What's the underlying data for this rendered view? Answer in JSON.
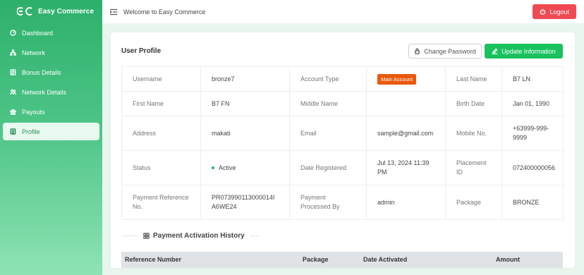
{
  "brand": {
    "name": "Easy Commerce"
  },
  "sidebar": {
    "items": [
      {
        "label": "Dashboard",
        "icon": "dashboard-icon"
      },
      {
        "label": "Network",
        "icon": "network-icon"
      },
      {
        "label": "Bonus Details",
        "icon": "bonus-icon"
      },
      {
        "label": "Network Details",
        "icon": "users-icon"
      },
      {
        "label": "Payouts",
        "icon": "bank-icon"
      },
      {
        "label": "Profile",
        "icon": "profile-icon",
        "active": true
      }
    ]
  },
  "topbar": {
    "welcome": "Welcome to Easy Commerce",
    "logout": "Logout"
  },
  "profile": {
    "title": "User Profile",
    "change_password": "Change Password",
    "update_info": "Update Information",
    "rows": [
      {
        "l1": "Username",
        "v1": "bronze7",
        "l2": "Account Type",
        "v2": "Main Account",
        "l3": "Last Name",
        "v3": "B7 LN"
      },
      {
        "l1": "First Name",
        "v1": "B7 FN",
        "l2": "Middle Name",
        "v2": "",
        "l3": "Birth Date",
        "v3": "Jan 01, 1990"
      },
      {
        "l1": "Address",
        "v1": "makati",
        "l2": "Email",
        "v2": "sample@gmail.com",
        "l3": "Mobile No.",
        "v3": "+63999-999-9999"
      },
      {
        "l1": "Status",
        "v1": "Active",
        "l2": "Date Registered",
        "v2": "Jul 13, 2024 11:39 PM",
        "l3": "Placement ID",
        "v3": "072400000056"
      },
      {
        "l1": "Payment Reference No.",
        "v1": "PR073990113000014IA6WE24",
        "l2": "Payment Processed By",
        "v2": "admin",
        "l3": "Package",
        "v3": "BRONZE"
      }
    ]
  },
  "history": {
    "title": "Payment Activation History",
    "columns": [
      "Reference Number",
      "Package",
      "Date Activated",
      "Amount"
    ]
  },
  "colors": {
    "accent": "#19c25f",
    "danger": "#ef4a52",
    "badge": "#e8590c"
  }
}
